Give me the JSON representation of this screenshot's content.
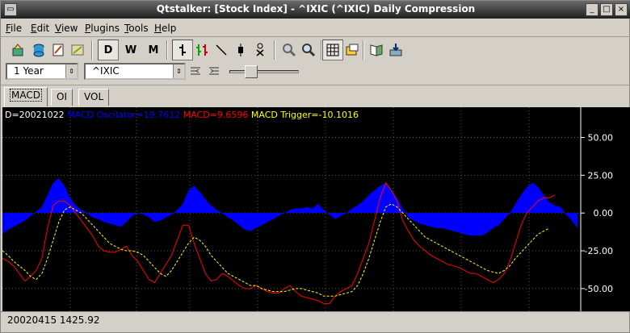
{
  "window": {
    "title": "Qtstalker: [Stock Index] - ^IXIC (^IXIC) Daily Compression"
  },
  "menu": [
    "File",
    "Edit",
    "View",
    "Plugins",
    "Tools",
    "Help"
  ],
  "toolbar": {
    "compression_buttons": [
      "D",
      "W",
      "M"
    ],
    "icons": [
      "open-chart-icon",
      "database-icon",
      "new-indicator-icon",
      "options-icon",
      "bar-chart-icon",
      "candle-chart-icon",
      "line-tool-icon",
      "swing-icon",
      "point-figure-icon",
      "zoom-out-icon",
      "zoom-in-icon",
      "grid-icon",
      "scale-icon",
      "quotes-icon",
      "export-icon"
    ]
  },
  "toolbar2": {
    "range": "1 Year",
    "symbol": "^IXIC"
  },
  "tabs": [
    "MACD",
    "OI",
    "VOL"
  ],
  "chart_data": {
    "type": "line",
    "info": {
      "date": "D=20021022",
      "oscillator": "MACD Oscilator=19.7612",
      "macd": "MACD=9.6596",
      "trigger": "MACD Trigger=-10.1016"
    },
    "colors": {
      "oscillator": "#0000ff",
      "macd": "#ff0000",
      "trigger": "#ffff00",
      "grid": "#555555",
      "axis_text": "#ffffff"
    },
    "ylim": [
      -65,
      70
    ],
    "yticks": [
      50,
      25,
      0,
      -25,
      -50
    ],
    "ytick_labels": [
      "50.00",
      "25.00",
      "0.00",
      "-25.00",
      "-50.00"
    ],
    "grid": true,
    "series": [
      {
        "name": "MACD Oscilator",
        "type": "area",
        "values": [
          -14,
          -11,
          -9,
          -7,
          -5,
          -2,
          1,
          4,
          12,
          20,
          23,
          18,
          10,
          5,
          2,
          0,
          -3,
          -4,
          -6,
          -7,
          -8,
          -9,
          -6,
          -2,
          0,
          -1,
          -3,
          -6,
          -5,
          -3,
          -1,
          2,
          6,
          15,
          18,
          14,
          9,
          5,
          2,
          0,
          -3,
          -5,
          -8,
          -11,
          -12,
          -10,
          -8,
          -6,
          -4,
          -2,
          0,
          2,
          3,
          3,
          4,
          3,
          6,
          2,
          -1,
          -4,
          -2,
          0,
          3,
          5,
          8,
          12,
          15,
          18,
          20,
          15,
          10,
          3,
          -3,
          -5,
          -7,
          -8,
          -9,
          -10,
          -10,
          -11,
          -12,
          -13,
          -14,
          -15,
          -15,
          -15,
          -13,
          -10,
          -8,
          -4,
          0,
          6,
          12,
          17,
          20,
          17,
          12,
          7,
          5,
          4,
          -1,
          -5,
          -10
        ]
      },
      {
        "name": "MACD",
        "type": "line",
        "values": [
          -30,
          -32,
          -35,
          -40,
          -45,
          -42,
          -38,
          -30,
          -10,
          5,
          8,
          8,
          5,
          0,
          -5,
          -10,
          -15,
          -22,
          -25,
          -26,
          -26,
          -24,
          -22,
          -28,
          -32,
          -38,
          -44,
          -46,
          -40,
          -34,
          -28,
          -18,
          -8,
          -8,
          -20,
          -30,
          -40,
          -45,
          -44,
          -40,
          -42,
          -45,
          -48,
          -50,
          -50,
          -48,
          -50,
          -52,
          -53,
          -53,
          -50,
          -48,
          -52,
          -55,
          -56,
          -57,
          -58,
          -60,
          -60,
          -55,
          -52,
          -50,
          -48,
          -40,
          -30,
          -20,
          -5,
          10,
          20,
          15,
          8,
          -5,
          -12,
          -18,
          -22,
          -25,
          -28,
          -30,
          -32,
          -34,
          -35,
          -36,
          -38,
          -40,
          -40,
          -42,
          -44,
          -46,
          -44,
          -40,
          -32,
          -20,
          -8,
          0,
          4,
          8,
          10,
          10,
          12
        ]
      },
      {
        "name": "MACD Trigger",
        "type": "line",
        "values": [
          -25,
          -28,
          -32,
          -35,
          -38,
          -42,
          -44,
          -40,
          -30,
          -18,
          -6,
          2,
          4,
          2,
          0,
          -4,
          -8,
          -12,
          -16,
          -20,
          -22,
          -24,
          -25,
          -25,
          -26,
          -28,
          -32,
          -36,
          -40,
          -42,
          -38,
          -32,
          -26,
          -20,
          -16,
          -18,
          -22,
          -28,
          -32,
          -36,
          -40,
          -42,
          -44,
          -46,
          -48,
          -48,
          -50,
          -51,
          -52,
          -52,
          -52,
          -51,
          -50,
          -50,
          -51,
          -52,
          -53,
          -55,
          -55,
          -55,
          -54,
          -53,
          -52,
          -48,
          -40,
          -30,
          -18,
          -6,
          4,
          6,
          4,
          0,
          -4,
          -8,
          -12,
          -16,
          -18,
          -20,
          -22,
          -24,
          -26,
          -28,
          -30,
          -32,
          -34,
          -36,
          -38,
          -39,
          -40,
          -38,
          -35,
          -30,
          -26,
          -22,
          -18,
          -14,
          -12,
          -10
        ]
      }
    ]
  },
  "status": "20020415 1425.92"
}
